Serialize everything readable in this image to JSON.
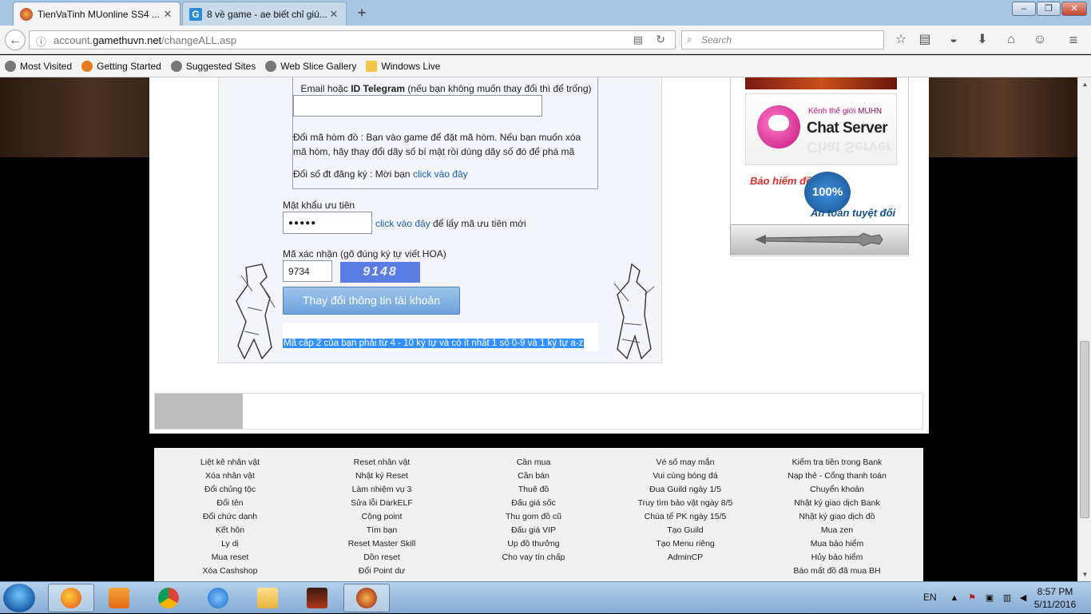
{
  "browser": {
    "tabs": [
      {
        "title": "TienVaTinh MUonline SS4 ...",
        "active": true
      },
      {
        "title": "8 về game - ae biết chỉ giú...",
        "active": false
      }
    ],
    "url_prefix": "account.",
    "url_domain": "gamethuvn.net",
    "url_path": "/changeALL.asp",
    "search_placeholder": "Search",
    "bookmarks": [
      "Most Visited",
      "Getting Started",
      "Suggested Sites",
      "Web Slice Gallery",
      "Windows Live"
    ],
    "window_controls": {
      "minimize": "–",
      "maximize": "❐",
      "close": "✕"
    },
    "nav_icons": {
      "back": "←",
      "info": "ⓘ",
      "reader": "▤",
      "reload": "↻",
      "new_tab": "+"
    }
  },
  "form": {
    "email_label_prefix": "Email hoặc ",
    "email_label_bold": "ID Telegram",
    "email_label_suffix": " (nếu bạn không muốn thay đổi thì để trống)",
    "email_value": "",
    "chest_line1": "Đổi mã hòm đồ : Bạn vào game để đặt mã hòm. Nếu bạn muốn xóa",
    "chest_line2": "mã hòm, hãy thay đổi dãy số bí mật rồi dùng dãy số đó để phá mã",
    "phone_text": "Đổi số đt đăng ký : Mời bạn ",
    "phone_link": "click vào đây",
    "priority_label": "Mật khẩu ưu tiên",
    "priority_value": "●●●●●",
    "priority_link": "click vào đây",
    "priority_suffix": " để lấy mã ưu tiên mới",
    "captcha_label": "Mã xác nhận (gõ đúng ký tự viết HOA)",
    "captcha_value": "9734",
    "captcha_image_text": "9148",
    "submit_label": "Thay đổi thông tin tài khoản",
    "notice": "Mã cấp 2 của bạn phải từ 4 - 10 ký tự và có ít nhất 1 số 0-9 và 1 ký tự a-z"
  },
  "sidebar": {
    "chat_kenh": "Kênh thế giới ",
    "chat_kenh_brand": "MUHN",
    "chat_title": "Chat Server",
    "insurance_top": "Bảo hiểm đồ",
    "insurance_seal": "100%",
    "insurance_bottom": "An toàn tuyệt đối"
  },
  "footer": {
    "columns": [
      [
        "Liệt kê nhân vật",
        "Xóa nhân vật",
        "Đổi chủng tộc",
        "Đổi tên",
        "Đổi chức danh",
        "Kết hôn",
        "Ly dị",
        "Mua reset",
        "Xóa Cashshop"
      ],
      [
        "Reset nhân vật",
        "Nhật ký Reset",
        "Làm nhiệm vụ 3",
        "Sửa lỗi DarkELF",
        "Cộng point",
        "Tìm bạn",
        "Reset Master Skill",
        "Dồn reset",
        "Đổi Point dư"
      ],
      [
        "Cần mua",
        "Cần bán",
        "Thuê đồ",
        "Đấu giá sốc",
        "Thu gom đồ cũ",
        "Đấu giá VIP",
        "Up đồ thưởng",
        "Cho vay tín chấp"
      ],
      [
        "Vé số may mắn",
        "Vui cùng bóng đá",
        "Đua Guild ngày 1/5",
        "Truy tìm bảo vật ngày 8/5",
        "Chúa tể PK ngày 15/5",
        "Tạo Guild",
        "Tạo Menu riêng",
        "AdminCP"
      ],
      [
        "Kiểm tra tiền trong Bank",
        "Nạp thẻ - Cổng thanh toán",
        "Chuyển khoản",
        "Nhật ký giao dịch Bank",
        "Nhật ký giao dịch đồ",
        "Mua zen",
        "Mua bảo hiểm",
        "Hủy bảo hiểm",
        "Báo mất đồ đã mua BH"
      ]
    ]
  },
  "taskbar": {
    "language": "EN",
    "time": "8:57 PM",
    "date": "5/11/2016",
    "apps": [
      "firefox-icon",
      "media-player-icon",
      "chrome-icon",
      "ie-icon",
      "explorer-icon",
      "mu-game-icon",
      "mu-launcher-icon"
    ]
  },
  "colors": {
    "link": "#1a5fb4",
    "button": "#6fa3db",
    "selection": "#3390ff",
    "taskbar": "#87acd3"
  }
}
